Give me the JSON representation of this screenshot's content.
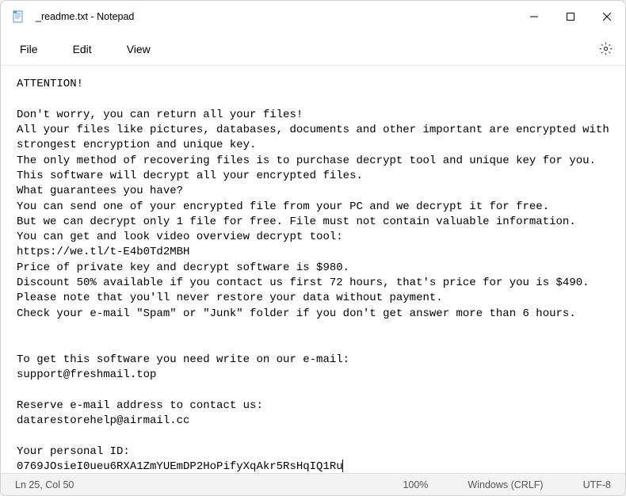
{
  "titlebar": {
    "title": "_readme.txt - Notepad"
  },
  "menu": {
    "file": "File",
    "edit": "Edit",
    "view": "View"
  },
  "content": {
    "text": "ATTENTION!\n\nDon't worry, you can return all your files!\nAll your files like pictures, databases, documents and other important are encrypted with strongest encryption and unique key.\nThe only method of recovering files is to purchase decrypt tool and unique key for you.\nThis software will decrypt all your encrypted files.\nWhat guarantees you have?\nYou can send one of your encrypted file from your PC and we decrypt it for free.\nBut we can decrypt only 1 file for free. File must not contain valuable information.\nYou can get and look video overview decrypt tool:\nhttps://we.tl/t-E4b0Td2MBH\nPrice of private key and decrypt software is $980.\nDiscount 50% available if you contact us first 72 hours, that's price for you is $490.\nPlease note that you'll never restore your data without payment.\nCheck your e-mail \"Spam\" or \"Junk\" folder if you don't get answer more than 6 hours.\n\n\nTo get this software you need write on our e-mail:\nsupport@freshmail.top\n\nReserve e-mail address to contact us:\ndatarestorehelp@airmail.cc\n\nYour personal ID:\n0769JOsieI0ueu6RXA1ZmYUEmDP2HoPifyXqAkr5RsHqIQ1Ru"
  },
  "statusbar": {
    "position": "Ln 25, Col 50",
    "zoom": "100%",
    "lineending": "Windows (CRLF)",
    "encoding": "UTF-8"
  }
}
